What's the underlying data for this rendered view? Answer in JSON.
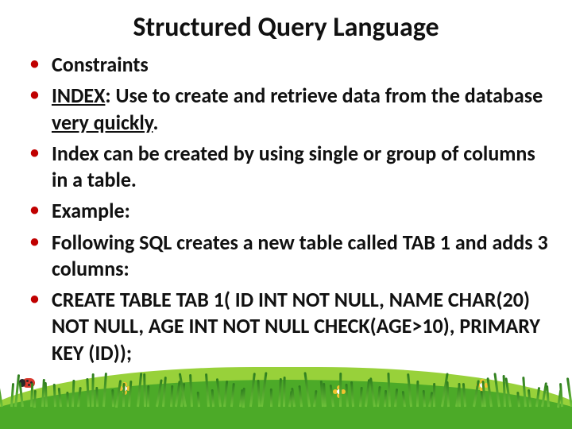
{
  "title": "Structured Query Language",
  "bullets": {
    "b0": "Constraints",
    "b1_a": "INDEX",
    "b1_b": ": Use to create and retrieve data from the database ",
    "b1_c": "very quickly",
    "b1_d": ".",
    "b2": "Index can be created by using single or group of columns in a table.",
    "b3": "Example:",
    "b4": "Following SQL creates a new table called TAB 1 and adds 3 columns:",
    "b5": "CREATE TABLE TAB 1( ID INT NOT NULL, NAME CHAR(20) NOT NULL, AGE INT NOT NULL CHECK(AGE>10), PRIMARY KEY (ID));"
  },
  "colors": {
    "bullet_dot": "#c00000",
    "grass_light": "#98d13a",
    "grass_dark": "#4caa28",
    "flower": "#f0c330",
    "ladybug": "#d8392e"
  }
}
